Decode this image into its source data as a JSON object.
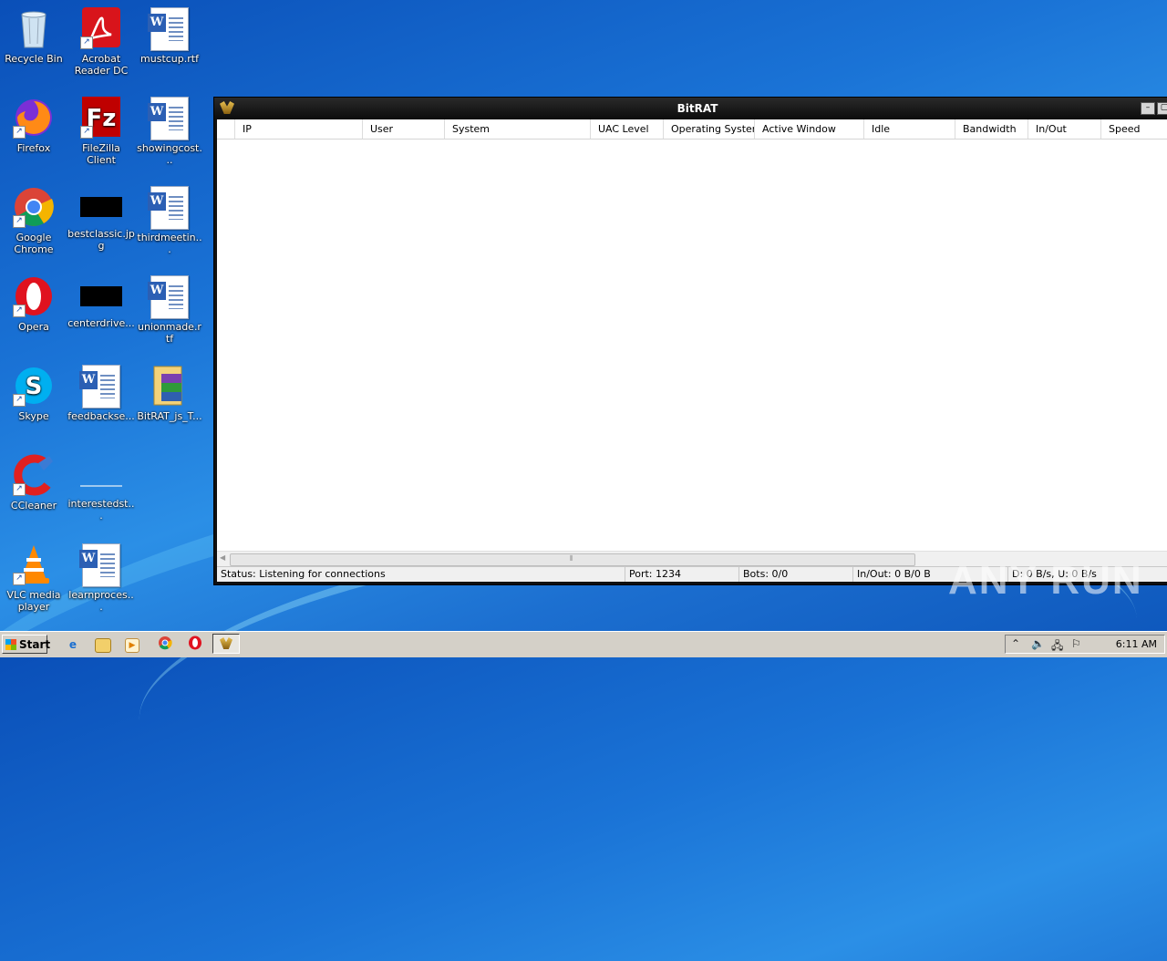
{
  "desktop": {
    "icons": [
      {
        "label": "Recycle Bin"
      },
      {
        "label": "Acrobat Reader DC"
      },
      {
        "label": "mustcup.rtf"
      },
      {
        "label": "Firefox"
      },
      {
        "label": "FileZilla Client"
      },
      {
        "label": "showingcost..."
      },
      {
        "label": "Google Chrome"
      },
      {
        "label": "bestclassic.jpg"
      },
      {
        "label": "thirdmeetin..."
      },
      {
        "label": "Opera"
      },
      {
        "label": "centerdrive..."
      },
      {
        "label": "unionmade.rtf"
      },
      {
        "label": "Skype"
      },
      {
        "label": "feedbackse..."
      },
      {
        "label": "BitRAT_js_T..."
      },
      {
        "label": "CCleaner"
      },
      {
        "label": "interestedst..."
      },
      {
        "label": "VLC media player"
      },
      {
        "label": "learnproces..."
      }
    ]
  },
  "window": {
    "title": "BitRAT",
    "columns": [
      "IP",
      "User",
      "System",
      "UAC Level",
      "Operating System",
      "Active Window",
      "Idle",
      "Bandwidth",
      "In/Out",
      "Speed"
    ],
    "status": {
      "status": "Status: Listening for connections",
      "port": "Port: 1234",
      "bots": "Bots: 0/0",
      "inout": "In/Out: 0 B/0 B",
      "speed": "D: 0 B/s, U: 0 B/s"
    }
  },
  "watermark": "ANY RUN",
  "taskbar": {
    "start_label": "Start",
    "clock": "6:11 AM"
  },
  "colors": {
    "desktop_blue": "#1a73d6",
    "window_titlebar": "#101010",
    "taskbar": "#d4d0c8"
  }
}
